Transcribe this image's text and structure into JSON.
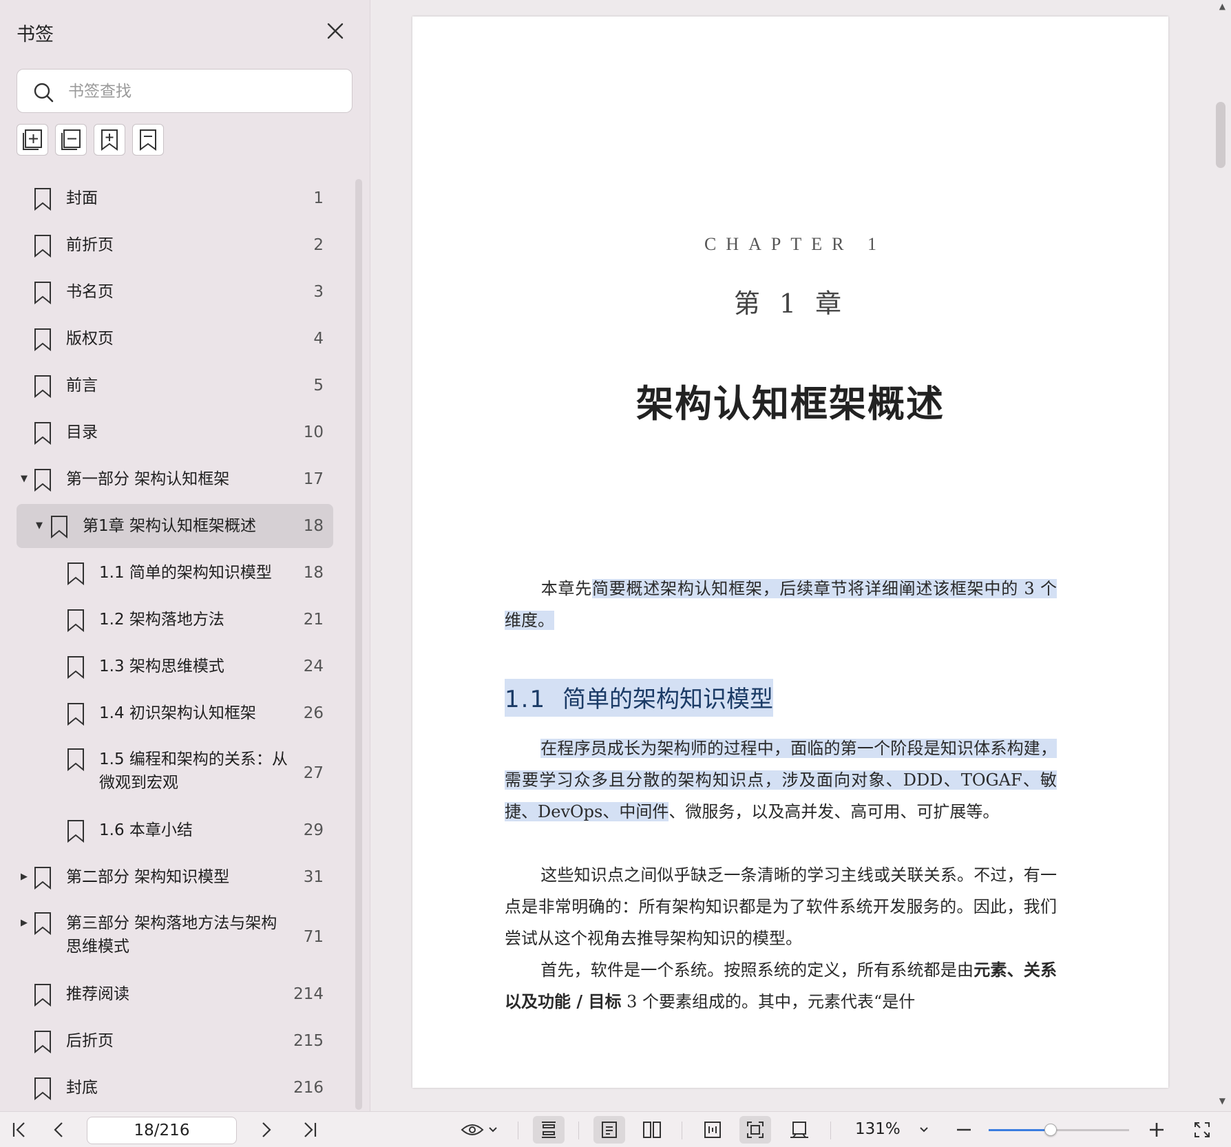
{
  "sidebar": {
    "title": "书签",
    "search_placeholder": "书签查找",
    "tools": [
      "expand-all-icon",
      "collapse-all-icon",
      "add-bookmark-icon",
      "bookmark-icon"
    ],
    "items": [
      {
        "label": "封面",
        "page": "1",
        "level": 0,
        "arrow": ""
      },
      {
        "label": "前折页",
        "page": "2",
        "level": 0,
        "arrow": ""
      },
      {
        "label": "书名页",
        "page": "3",
        "level": 0,
        "arrow": ""
      },
      {
        "label": "版权页",
        "page": "4",
        "level": 0,
        "arrow": ""
      },
      {
        "label": "前言",
        "page": "5",
        "level": 0,
        "arrow": ""
      },
      {
        "label": "目录",
        "page": "10",
        "level": 0,
        "arrow": ""
      },
      {
        "label": "第一部分 架构认知框架",
        "page": "17",
        "level": 0,
        "arrow": "down"
      },
      {
        "label": "第1章 架构认知框架概述",
        "page": "18",
        "level": 1,
        "arrow": "down",
        "active": true
      },
      {
        "label": "1.1 简单的架构知识模型",
        "page": "18",
        "level": 2,
        "arrow": ""
      },
      {
        "label": "1.2 架构落地方法",
        "page": "21",
        "level": 2,
        "arrow": ""
      },
      {
        "label": "1.3 架构思维模式",
        "page": "24",
        "level": 2,
        "arrow": ""
      },
      {
        "label": "1.4 初识架构认知框架",
        "page": "26",
        "level": 2,
        "arrow": ""
      },
      {
        "label": "1.5 编程和架构的关系：从",
        "label2": "微观到宏观",
        "page": "27",
        "level": 2,
        "arrow": ""
      },
      {
        "label": "1.6 本章小结",
        "page": "29",
        "level": 2,
        "arrow": ""
      },
      {
        "label": "第二部分 架构知识模型",
        "page": "31",
        "level": 0,
        "arrow": "right"
      },
      {
        "label": "第三部分 架构落地方法与架构",
        "label2": "思维模式",
        "page": "71",
        "level": 0,
        "arrow": "right"
      },
      {
        "label": "推荐阅读",
        "page": "214",
        "level": 0,
        "arrow": ""
      },
      {
        "label": "后折页",
        "page": "215",
        "level": 0,
        "arrow": ""
      },
      {
        "label": "封底",
        "page": "216",
        "level": 0,
        "arrow": ""
      }
    ]
  },
  "document": {
    "chapter_en": "CHAPTER 1",
    "chapter_cn": "第 1 章",
    "chapter_title": "架构认知框架概述",
    "intro_plain": "本章先",
    "intro_highlight": "简要概述架构认知框架，后续章节将详细阐述该框架中的 3 个维度。",
    "section_num": "1.1",
    "section_title": "简单的架构知识模型",
    "p1_highlight": "在程序员成长为架构师的过程中，面临的第一个阶段是知识体系构建，需要学习众多且分散的架构知识点，涉及面向对象、DDD、TOGAF、敏捷、DevOps、中间件",
    "p1_plain": "、微服务，以及高并发、高可用、可扩展等。",
    "p2": "这些知识点之间似乎缺乏一条清晰的学习主线或关联关系。不过，有一点是非常明确的：所有架构知识都是为了软件系统开发服务的。因此，我们尝试从这个视角去推导架构知识的模型。",
    "p3_plain1": "首先，软件是一个系统。按照系统的定义，所有系统都是由",
    "p3_bold": "元素、关系以及功能 / 目标",
    "p3_plain2": " 3 个要素组成的。其中，元素代表“是什"
  },
  "toolbar": {
    "page_indicator": "18/216",
    "zoom": "131%",
    "zoom_fraction": 0.44
  },
  "colors": {
    "highlight": "#d4e0f4",
    "accent": "#3a7de0",
    "section_text": "#1b3b66"
  }
}
